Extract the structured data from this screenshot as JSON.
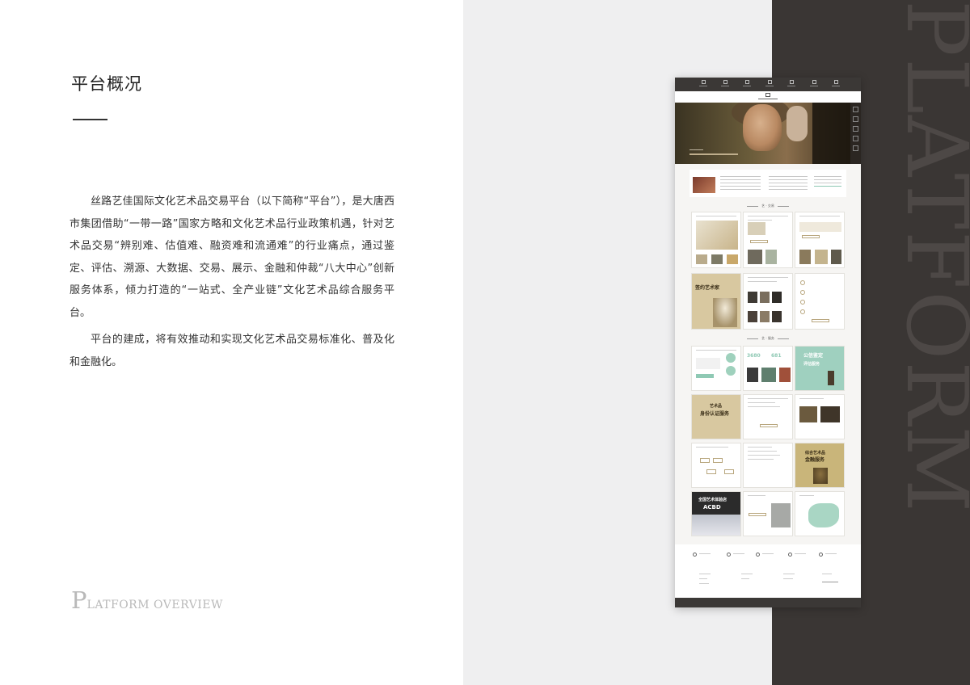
{
  "page": {
    "title": "平台概况",
    "paragraphs": [
      "丝路艺佳国际文化艺术品交易平台（以下简称“平台”），是大唐西市集团借助“一带一路”国家方略和文化艺术品行业政策机遇，针对艺术品交易“辨别难、估值难、融资难和流通难”的行业痛点，通过鉴定、评估、溯源、大数据、交易、展示、金融和仲裁“八大中心”创新服务体系，倾力打造的“一站式、全产业链”文化艺术品综合服务平台。",
      "平台的建成，将有效推动和实现文化艺术品交易标准化、普及化和金融化。"
    ],
    "footer_label": {
      "initial": "P",
      "rest": "LATFORM OVERVIEW"
    },
    "watermark": "PLATFORM"
  },
  "mockup": {
    "section_trade": "艺 · 交易",
    "section_service": "艺 · 服务",
    "card_artist": "签约艺术家",
    "card_identity_line1": "艺术品",
    "card_identity_line2": "身份认证服务",
    "card_appraisal_line1": "公信鉴定",
    "card_appraisal_line2": "评估服务",
    "card_finance_line1": "综合艺术品",
    "card_finance_line2": "金融服务",
    "card_acbd_line1": "全国艺术体验店",
    "card_acbd_line2": "ACBD",
    "stat_1": "3680",
    "stat_2": "681"
  },
  "colors": {
    "grey_panel": "#efeff0",
    "dark_panel": "#3a3634",
    "accent_gold": "#b8a67d",
    "accent_green": "#8fc9b4"
  }
}
